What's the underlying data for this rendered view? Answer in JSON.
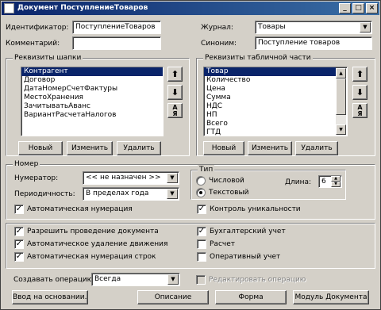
{
  "window": {
    "title": "Документ ПоступлениеТоваров",
    "minimize": "_",
    "maximize": "□",
    "close": "×"
  },
  "header": {
    "identifier_label": "Идентификатор:",
    "identifier_value": "ПоступлениеТоваров",
    "comment_label": "Комментарий:",
    "comment_value": "",
    "journal_label": "Журнал:",
    "journal_value": "Товары",
    "synonym_label": "Синоним:",
    "synonym_value": "Поступление товаров"
  },
  "attributes": {
    "title": "Реквизиты шапки",
    "items": [
      "Контрагент",
      "Договор",
      "ДатаНомерСчетФактуры",
      "МестоХранения",
      "ЗачитыватьАванс",
      "ВариантРасчетаНалогов"
    ],
    "selected_index": 0,
    "buttons": {
      "new": "Новый",
      "edit": "Изменить",
      "delete": "Удалить"
    }
  },
  "table_attributes": {
    "title": "Реквизиты табличной части",
    "items": [
      "Товар",
      "Количество",
      "Цена",
      "Сумма",
      "НДС",
      "НП",
      "Всего",
      "ГТД"
    ],
    "selected_index": 0,
    "buttons": {
      "new": "Новый",
      "edit": "Изменить",
      "delete": "Удалить"
    }
  },
  "move_buttons": {
    "up": "⬆",
    "down": "⬇",
    "sort_top": "А",
    "sort_bottom": "Я"
  },
  "number": {
    "title": "Номер",
    "numerator_label": "Нумератор:",
    "numerator_value": "<< не назначен >>",
    "periodicity_label": "Периодичность:",
    "periodicity_value": "В пределах года",
    "auto_numbering_label": "Автоматическая нумерация",
    "auto_numbering_checked": true,
    "uniqueness_label": "Контроль уникальности",
    "uniqueness_checked": true,
    "type_title": "Тип",
    "type_numeric": "Числовой",
    "type_text": "Текстовый",
    "type_selected": "Текстовый",
    "length_label": "Длина:",
    "length_value": "6"
  },
  "options": {
    "allow_posting": "Разрешить проведение документа",
    "allow_posting_checked": true,
    "auto_delete_movements": "Автоматическое удаление движения",
    "auto_delete_movements_checked": true,
    "auto_number_rows": "Автоматическая нумерация строк",
    "auto_number_rows_checked": true,
    "accounting": "Бухгалтерский учет",
    "accounting_checked": true,
    "calculation": "Расчет",
    "calculation_checked": false,
    "operational": "Оперативный учет",
    "operational_checked": false
  },
  "create_operation": {
    "label": "Создавать операцию:",
    "value": "Всегда",
    "edit_operation_label": "Редактировать операцию",
    "edit_operation_checked": false
  },
  "footer": {
    "basis_for_input": "Ввод на основании...",
    "journal_graph": "Описание",
    "forms": "Форма",
    "movements_button": "Модуль Документа"
  },
  "colors": {
    "face": "#d4d0c8",
    "title_start": "#0a246a",
    "title_end": "#3a6ea5",
    "selection": "#0a246a"
  }
}
